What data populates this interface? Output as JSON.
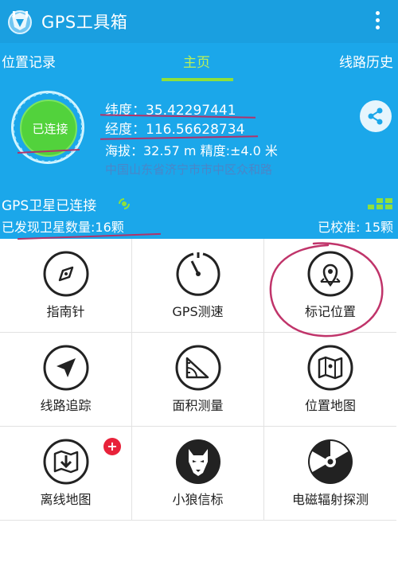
{
  "appbar": {
    "title": "GPS工具箱",
    "logo_icon": "gps-tool-logo-icon",
    "menu_icon": "more-vert-icon"
  },
  "tabs": [
    {
      "label": "位置记录",
      "selected": false
    },
    {
      "label": "主页",
      "selected": true
    },
    {
      "label": "线路历史",
      "selected": false
    }
  ],
  "status": {
    "connection_label": "已连接",
    "latitude": "纬度：35.42297441",
    "longitude": "经度：116.56628734",
    "altitude_accuracy": "海拔：32.57 m   精度:±4.0 米",
    "address": "中国山东省济宁市市中区众和路",
    "share_icon": "share-icon"
  },
  "satellite": {
    "title": "GPS卫星已连接",
    "found": "已发现卫星数量:16颗",
    "calibrated": "已校准: 15颗",
    "signal_icon": "gps-signal-icon",
    "bars_icon": "signal-bars-icon"
  },
  "tools": [
    {
      "label": "指南针",
      "icon": "compass-icon"
    },
    {
      "label": "GPS测速",
      "icon": "speedometer-icon"
    },
    {
      "label": "标记位置",
      "icon": "map-pin-icon"
    },
    {
      "label": "线路追踪",
      "icon": "navigation-arrow-icon"
    },
    {
      "label": "面积测量",
      "icon": "protractor-icon"
    },
    {
      "label": "位置地图",
      "icon": "map-icon"
    },
    {
      "label": "离线地图",
      "icon": "offline-map-icon",
      "badge": "+"
    },
    {
      "label": "小狼信标",
      "icon": "wolf-icon"
    },
    {
      "label": "电磁辐射探测",
      "icon": "radiation-icon"
    }
  ],
  "colors": {
    "primary": "#1ba7ea",
    "tab_active": "#8fe03c",
    "connected": "#52d23c",
    "annotation": "#b1336a",
    "badge": "#e8223a"
  }
}
